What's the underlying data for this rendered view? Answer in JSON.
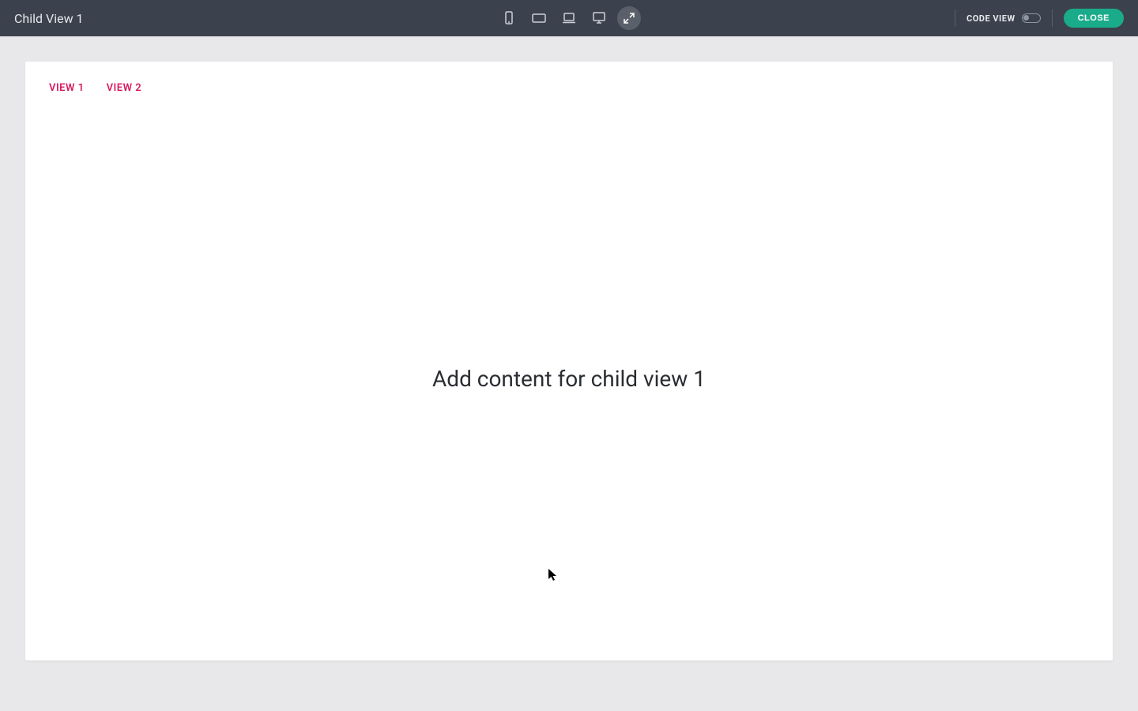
{
  "header": {
    "title": "Child View 1",
    "code_view_label": "CODE VIEW",
    "close_label": "CLOSE"
  },
  "device_icons": {
    "phone": "phone-portrait-icon",
    "tablet_landscape": "tablet-landscape-icon",
    "laptop": "laptop-icon",
    "desktop": "desktop-icon",
    "fullscreen": "expand-icon"
  },
  "tabs": [
    {
      "label": "VIEW 1"
    },
    {
      "label": "VIEW 2"
    }
  ],
  "content": {
    "placeholder": "Add content for child view 1"
  }
}
